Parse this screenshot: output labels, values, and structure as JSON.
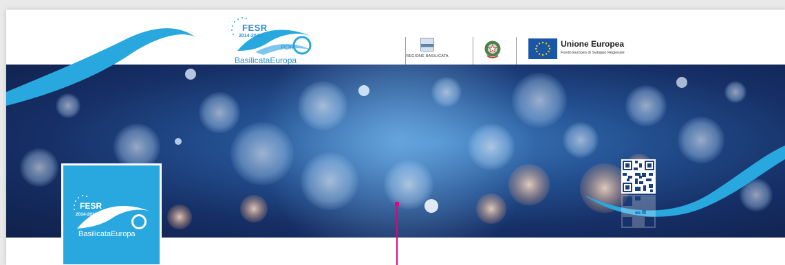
{
  "program_logo": {
    "badge": "FESR",
    "years": "2014-2020",
    "por": "POR",
    "name": "BasilicataEuropa"
  },
  "region_logo": {
    "label": "REGIONE BASILICATA"
  },
  "eu_logo": {
    "title": "Unione Europea",
    "subtitle": "Fondo Europeo di Sviluppo Regionale"
  },
  "colors": {
    "brand_blue": "#29a8e0",
    "guide_magenta": "#e5007e",
    "background_blue": "#1b3f7f"
  },
  "icons": [
    "fesr-logo-icon",
    "region-flag-icon",
    "italy-emblem-icon",
    "eu-flag-icon",
    "qr-code-icon"
  ]
}
